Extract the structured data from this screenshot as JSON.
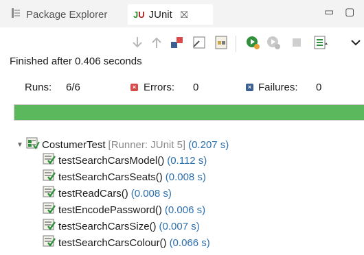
{
  "tabs": [
    {
      "label": "Package Explorer",
      "active": false
    },
    {
      "label": "JUnit",
      "active": true
    }
  ],
  "window_controls": {
    "minimize": "▭",
    "maximize": "▢"
  },
  "icons": {
    "package_explorer": "package-explorer-icon",
    "junit": "junit-icon",
    "close": "close-icon",
    "next_failure": "arrow-down-icon",
    "previous_failure": "arrow-up-icon",
    "show_failures_only": "show-failures-only-icon",
    "scroll_lock": "scroll-lock-icon",
    "show_skipped": "show-skipped-icon",
    "rerun": "rerun-icon",
    "rerun_failed_first": "rerun-failed-first-icon",
    "stop": "stop-icon",
    "test_run_history": "history-icon",
    "view_menu": "view-menu-icon"
  },
  "status": {
    "finished_text": "Finished after 0.406 seconds"
  },
  "counters": {
    "runs_label": "Runs:",
    "runs_value": "6/6",
    "errors_label": "Errors:",
    "errors_value": "0",
    "failures_label": "Failures:",
    "failures_value": "0"
  },
  "progress": {
    "fraction": 1.0,
    "color": "#5cb85c"
  },
  "tree": {
    "suite": {
      "name": "CostumerTest",
      "runner": "[Runner: JUnit 5]",
      "time": "(0.207 s)",
      "expanded": true
    },
    "tests": [
      {
        "name": "testSearchCarsModel()",
        "time": "(0.112 s)"
      },
      {
        "name": "testSearchCarsSeats()",
        "time": "(0.008 s)"
      },
      {
        "name": "testReadCars()",
        "time": "(0.008 s)"
      },
      {
        "name": "testEncodePassword()",
        "time": "(0.006 s)"
      },
      {
        "name": "testSearchCarsSize()",
        "time": "(0.007 s)"
      },
      {
        "name": "testSearchCarsColour()",
        "time": "(0.066 s)"
      }
    ]
  },
  "colors": {
    "success": "#5cb85c",
    "error": "#d94b4b",
    "failure": "#3b5f91",
    "time_text": "#2d6fad"
  }
}
